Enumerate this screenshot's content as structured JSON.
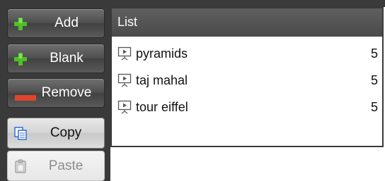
{
  "toolbar": {
    "add_label": "Add",
    "blank_label": "Blank",
    "remove_label": "Remove",
    "copy_label": "Copy",
    "paste_label": "Paste"
  },
  "list": {
    "header": "List",
    "items": [
      {
        "name": "pyramids",
        "count": "5",
        "icon": "slideshow-icon"
      },
      {
        "name": "taj mahal",
        "count": "5",
        "icon": "slideshow-icon"
      },
      {
        "name": "tour eiffel",
        "count": "5",
        "icon": "slideshow-icon"
      }
    ]
  },
  "colors": {
    "panel_dark": "#3a3a3a",
    "add_green": "#4fbf26",
    "remove_red": "#e0452c",
    "copy_blue": "#2f6fd6"
  }
}
